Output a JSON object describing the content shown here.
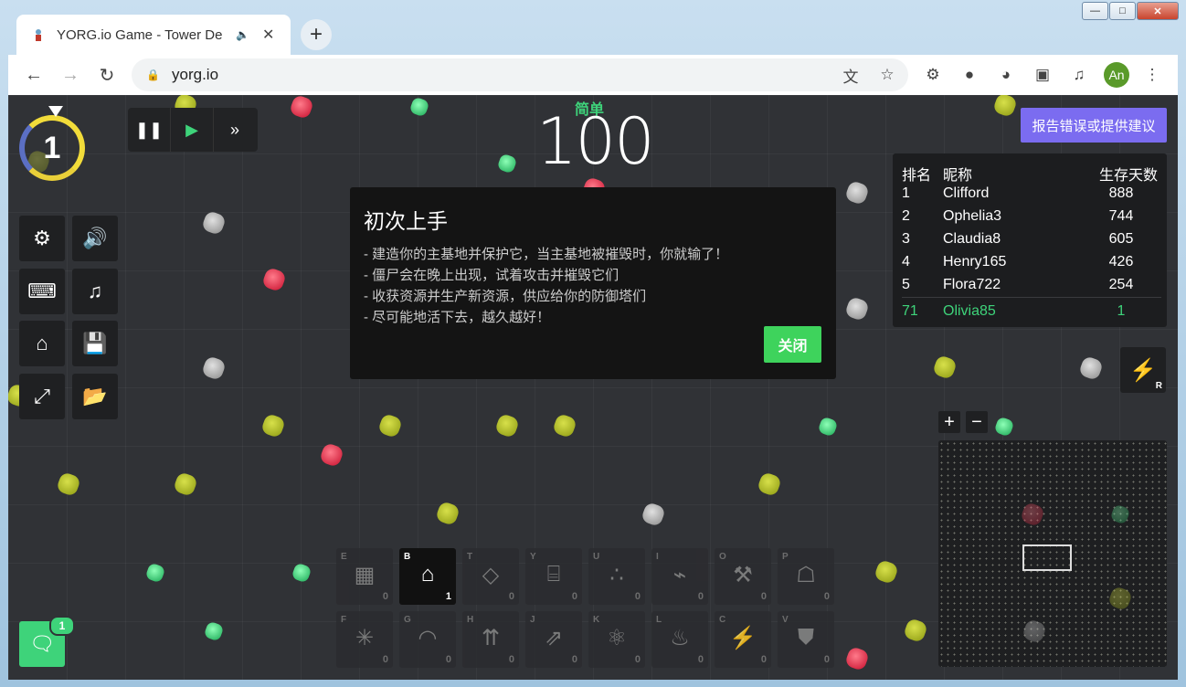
{
  "browser": {
    "tab_title": "YORG.io Game - Tower De",
    "url": "yorg.io",
    "profile_initials": "An"
  },
  "game": {
    "day": "1",
    "difficulty": "简单",
    "wave": "100",
    "report_button": "报告错误或提供建议",
    "leaderboard": {
      "headers": [
        "排名",
        "昵称",
        "生存天数"
      ],
      "rows": [
        {
          "rank": "1",
          "name": "Clifford",
          "days": "888"
        },
        {
          "rank": "2",
          "name": "Ophelia3",
          "days": "744"
        },
        {
          "rank": "3",
          "name": "Claudia8",
          "days": "605"
        },
        {
          "rank": "4",
          "name": "Henry165",
          "days": "426"
        },
        {
          "rank": "5",
          "name": "Flora722",
          "days": "254"
        }
      ],
      "me": {
        "rank": "71",
        "name": "Olivia85",
        "days": "1"
      }
    },
    "tutorial": {
      "title": "初次上手",
      "lines": [
        "- 建造你的主基地并保护它，当主基地被摧毁时，你就输了！",
        "- 僵尸会在晚上出现，试着攻击并摧毁它们",
        "- 收获资源并生产新资源，供应给你的防御塔们",
        "- 尽可能地活下去，越久越好！"
      ],
      "close_label": "关闭"
    },
    "energy_key": "R",
    "chat_badge": "1",
    "build_slots_row1": [
      {
        "key": "E",
        "count": "0",
        "icon": "wall-icon"
      },
      {
        "key": "B",
        "count": "1",
        "icon": "base-icon"
      },
      {
        "key": "T",
        "count": "0",
        "icon": "gem-icon"
      },
      {
        "key": "Y",
        "count": "0",
        "icon": "minecart-icon"
      },
      {
        "key": "U",
        "count": "0",
        "icon": "stone-pile-icon"
      },
      {
        "key": "I",
        "count": "0",
        "icon": "cannon-icon"
      },
      {
        "key": "O",
        "count": "0",
        "icon": "axe-icon"
      },
      {
        "key": "P",
        "count": "0",
        "icon": "factory-icon"
      }
    ],
    "build_slots_row2": [
      {
        "key": "F",
        "count": "0",
        "icon": "network-icon"
      },
      {
        "key": "G",
        "count": "0",
        "icon": "dome-icon"
      },
      {
        "key": "H",
        "count": "0",
        "icon": "arrows-icon"
      },
      {
        "key": "J",
        "count": "0",
        "icon": "multi-arrow-icon"
      },
      {
        "key": "K",
        "count": "0",
        "icon": "atom-icon"
      },
      {
        "key": "L",
        "count": "0",
        "icon": "smokestack-icon"
      },
      {
        "key": "C",
        "count": "0",
        "icon": "lightning-icon"
      },
      {
        "key": "V",
        "count": "0",
        "icon": "shield-icon"
      }
    ]
  }
}
